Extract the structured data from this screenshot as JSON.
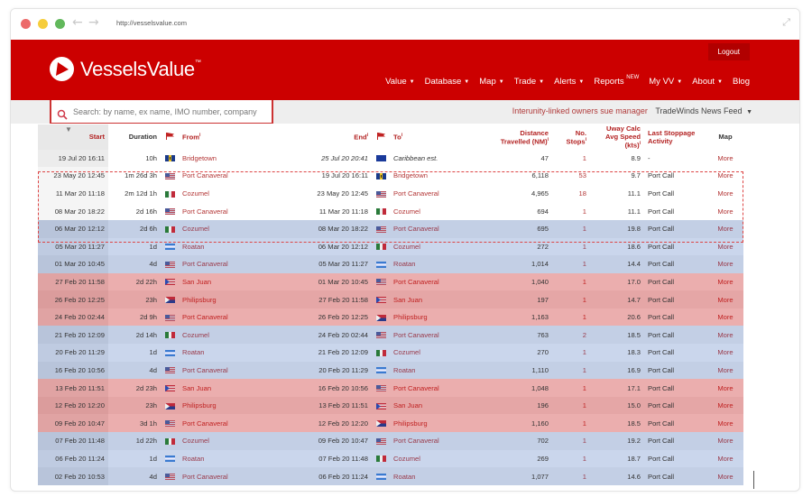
{
  "browser": {
    "url": "http://vesselsvalue.com",
    "back_icon": "arrow-left-icon",
    "forward_icon": "arrow-right-icon",
    "expand_icon": "expand-icon"
  },
  "header": {
    "logo_text": "VesselsValue",
    "logo_tm": "™",
    "logout_label": "Logout",
    "menu": [
      {
        "label": "Value",
        "dropdown": true
      },
      {
        "label": "Database",
        "dropdown": true
      },
      {
        "label": "Map",
        "dropdown": true
      },
      {
        "label": "Trade",
        "dropdown": true
      },
      {
        "label": "Alerts",
        "dropdown": true
      },
      {
        "label": "Reports",
        "badge": "NEW",
        "dropdown": false
      },
      {
        "label": "My VV",
        "dropdown": true
      },
      {
        "label": "About",
        "dropdown": true
      },
      {
        "label": "Blog",
        "dropdown": false
      }
    ],
    "caret": "▼"
  },
  "subbar": {
    "search_placeholder": "Search: by name, ex name, IMO number, company",
    "news_headline": "Interunity-linked owners sue manager",
    "news_feed_label": "TradeWinds News Feed",
    "news_feed_caret": "▼"
  },
  "colors": {
    "brand_red": "#cc0000",
    "link_red": "#b33636",
    "row_blue": "#c3cfe5",
    "row_red": "#ebaeae"
  },
  "table": {
    "columns": {
      "start": "Start",
      "duration": "Duration",
      "from": "From",
      "end": "End",
      "to": "To",
      "distance": "Distance Travelled (NM)",
      "stops": "No. Stops",
      "speed": "Uway Calc Avg Speed (kts)",
      "activity": "Last Stoppage Activity",
      "map": "Map"
    },
    "info_marker": "i",
    "rows": [
      {
        "start": "19 Jul 20 16:11",
        "duration": "10h",
        "from_flag": "barbados",
        "from": "Bridgetown",
        "end": "25 Jul 20 20:41",
        "to_flag": "caribbean",
        "to": "Caribbean est.",
        "distance": "47",
        "stops": "1",
        "speed": "8.9",
        "activity": "-",
        "map": "More",
        "style": "white",
        "estimated": true
      },
      {
        "start": "23 May 20 12:45",
        "duration": "1m 26d 3h",
        "from_flag": "usa",
        "from": "Port Canaveral",
        "end": "19 Jul 20 16:11",
        "to_flag": "barbados",
        "to": "Bridgetown",
        "distance": "6,118",
        "stops": "53",
        "speed": "9.7",
        "activity": "Port Call",
        "map": "More",
        "style": "hl"
      },
      {
        "start": "11 Mar 20 11:18",
        "duration": "2m 12d 1h",
        "from_flag": "mexico",
        "from": "Cozumel",
        "end": "23 May 20 12:45",
        "to_flag": "usa",
        "to": "Port Canaveral",
        "distance": "4,965",
        "stops": "18",
        "speed": "11.1",
        "activity": "Port Call",
        "map": "More",
        "style": "hl"
      },
      {
        "start": "08 Mar 20 18:22",
        "duration": "2d 16h",
        "from_flag": "usa",
        "from": "Port Canaveral",
        "end": "11 Mar 20 11:18",
        "to_flag": "mexico",
        "to": "Cozumel",
        "distance": "694",
        "stops": "1",
        "speed": "11.1",
        "activity": "Port Call",
        "map": "More",
        "style": "hl"
      },
      {
        "start": "06 Mar 20 12:12",
        "duration": "2d 6h",
        "from_flag": "mexico",
        "from": "Cozumel",
        "end": "08 Mar 20 18:22",
        "to_flag": "usa",
        "to": "Port Canaveral",
        "distance": "695",
        "stops": "1",
        "speed": "19.8",
        "activity": "Port Call",
        "map": "More",
        "style": "blue-a"
      },
      {
        "start": "05 Mar 20 11:27",
        "duration": "1d",
        "from_flag": "honduras",
        "from": "Roatan",
        "end": "06 Mar 20 12:12",
        "to_flag": "mexico",
        "to": "Cozumel",
        "distance": "272",
        "stops": "1",
        "speed": "18.6",
        "activity": "Port Call",
        "map": "More",
        "style": "blue-b"
      },
      {
        "start": "01 Mar 20 10:45",
        "duration": "4d",
        "from_flag": "usa",
        "from": "Port Canaveral",
        "end": "05 Mar 20 11:27",
        "to_flag": "honduras",
        "to": "Roatan",
        "distance": "1,014",
        "stops": "1",
        "speed": "14.4",
        "activity": "Port Call",
        "map": "More",
        "style": "blue-a"
      },
      {
        "start": "27 Feb 20 11:58",
        "duration": "2d 22h",
        "from_flag": "puerto-rico",
        "from": "San Juan",
        "end": "01 Mar 20 10:45",
        "to_flag": "usa",
        "to": "Port Canaveral",
        "distance": "1,040",
        "stops": "1",
        "speed": "17.0",
        "activity": "Port Call",
        "map": "More",
        "style": "red-a"
      },
      {
        "start": "26 Feb 20 12:25",
        "duration": "23h",
        "from_flag": "sint-maarten",
        "from": "Philipsburg",
        "end": "27 Feb 20 11:58",
        "to_flag": "puerto-rico",
        "to": "San Juan",
        "distance": "197",
        "stops": "1",
        "speed": "14.7",
        "activity": "Port Call",
        "map": "More",
        "style": "red-b"
      },
      {
        "start": "24 Feb 20 02:44",
        "duration": "2d 9h",
        "from_flag": "usa",
        "from": "Port Canaveral",
        "end": "26 Feb 20 12:25",
        "to_flag": "sint-maarten",
        "to": "Philipsburg",
        "distance": "1,163",
        "stops": "1",
        "speed": "20.6",
        "activity": "Port Call",
        "map": "More",
        "style": "red-a"
      },
      {
        "start": "21 Feb 20 12:09",
        "duration": "2d 14h",
        "from_flag": "mexico",
        "from": "Cozumel",
        "end": "24 Feb 20 02:44",
        "to_flag": "usa",
        "to": "Port Canaveral",
        "distance": "763",
        "stops": "2",
        "speed": "18.5",
        "activity": "Port Call",
        "map": "More",
        "style": "blue-a"
      },
      {
        "start": "20 Feb 20 11:29",
        "duration": "1d",
        "from_flag": "honduras",
        "from": "Roatan",
        "end": "21 Feb 20 12:09",
        "to_flag": "mexico",
        "to": "Cozumel",
        "distance": "270",
        "stops": "1",
        "speed": "18.3",
        "activity": "Port Call",
        "map": "More",
        "style": "blue-b"
      },
      {
        "start": "16 Feb 20 10:56",
        "duration": "4d",
        "from_flag": "usa",
        "from": "Port Canaveral",
        "end": "20 Feb 20 11:29",
        "to_flag": "honduras",
        "to": "Roatan",
        "distance": "1,110",
        "stops": "1",
        "speed": "16.9",
        "activity": "Port Call",
        "map": "More",
        "style": "blue-a"
      },
      {
        "start": "13 Feb 20 11:51",
        "duration": "2d 23h",
        "from_flag": "puerto-rico",
        "from": "San Juan",
        "end": "16 Feb 20 10:56",
        "to_flag": "usa",
        "to": "Port Canaveral",
        "distance": "1,048",
        "stops": "1",
        "speed": "17.1",
        "activity": "Port Call",
        "map": "More",
        "style": "red-a"
      },
      {
        "start": "12 Feb 20 12:20",
        "duration": "23h",
        "from_flag": "sint-maarten",
        "from": "Philipsburg",
        "end": "13 Feb 20 11:51",
        "to_flag": "puerto-rico",
        "to": "San Juan",
        "distance": "196",
        "stops": "1",
        "speed": "15.0",
        "activity": "Port Call",
        "map": "More",
        "style": "red-b"
      },
      {
        "start": "09 Feb 20 10:47",
        "duration": "3d 1h",
        "from_flag": "usa",
        "from": "Port Canaveral",
        "end": "12 Feb 20 12:20",
        "to_flag": "sint-maarten",
        "to": "Philipsburg",
        "distance": "1,160",
        "stops": "1",
        "speed": "18.5",
        "activity": "Port Call",
        "map": "More",
        "style": "red-a"
      },
      {
        "start": "07 Feb 20 11:48",
        "duration": "1d 22h",
        "from_flag": "mexico",
        "from": "Cozumel",
        "end": "09 Feb 20 10:47",
        "to_flag": "usa",
        "to": "Port Canaveral",
        "distance": "702",
        "stops": "1",
        "speed": "19.2",
        "activity": "Port Call",
        "map": "More",
        "style": "blue-a"
      },
      {
        "start": "06 Feb 20 11:24",
        "duration": "1d",
        "from_flag": "honduras",
        "from": "Roatan",
        "end": "07 Feb 20 11:48",
        "to_flag": "mexico",
        "to": "Cozumel",
        "distance": "269",
        "stops": "1",
        "speed": "18.7",
        "activity": "Port Call",
        "map": "More",
        "style": "blue-b"
      },
      {
        "start": "02 Feb 20 10:53",
        "duration": "4d",
        "from_flag": "usa",
        "from": "Port Canaveral",
        "end": "06 Feb 20 11:24",
        "to_flag": "honduras",
        "to": "Roatan",
        "distance": "1,077",
        "stops": "1",
        "speed": "14.6",
        "activity": "Port Call",
        "map": "More",
        "style": "blue-a"
      }
    ]
  }
}
